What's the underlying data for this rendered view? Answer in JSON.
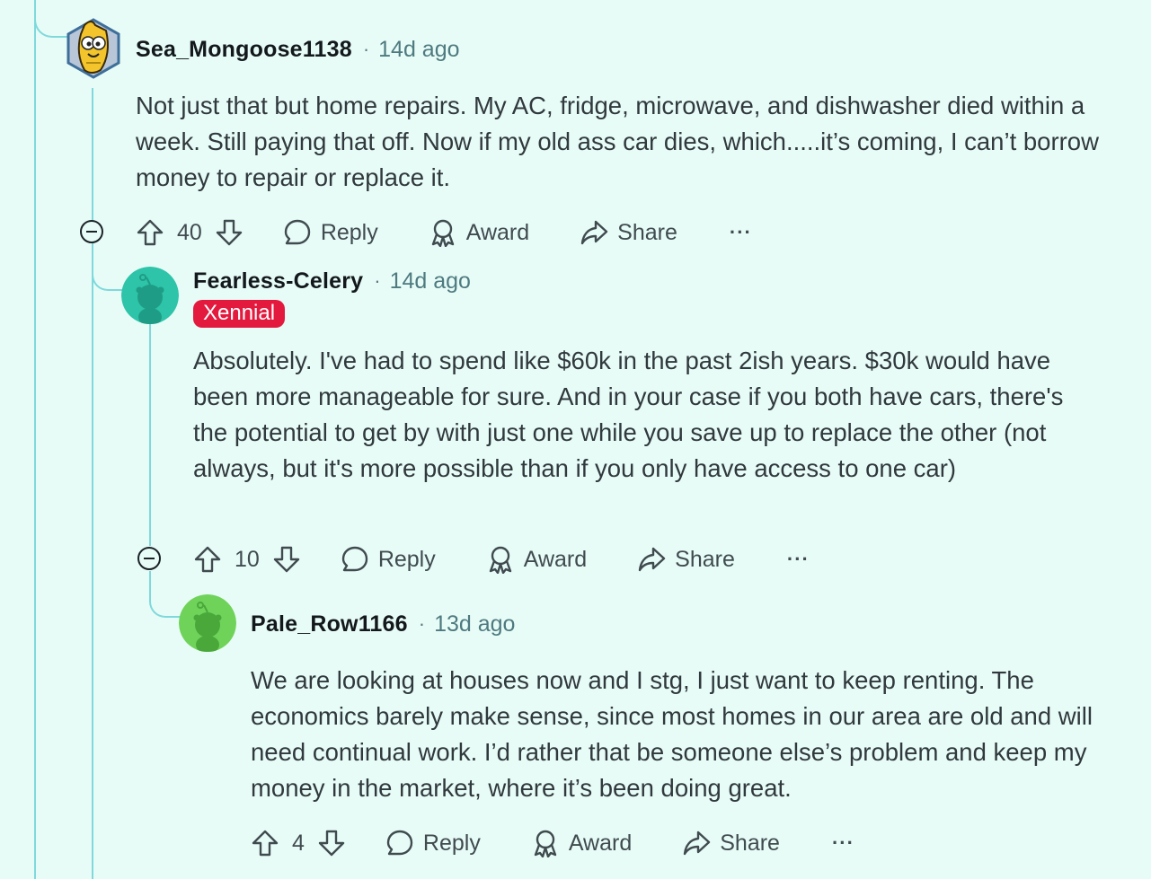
{
  "comments": [
    {
      "username": "Sea_Mongoose1138",
      "time": "14d ago",
      "avatar_icon": "banana-snoo-avatar-icon",
      "body": "Not just that but home repairs. My AC, fridge, microwave, and dishwasher died within a week. Still paying that off. Now if my old ass car dies, which.....it’s coming, I can’t borrow money to repair or replace it.",
      "votes": "40",
      "reply": "Reply",
      "award": "Award",
      "share": "Share",
      "more": "···"
    },
    {
      "username": "Fearless-Celery",
      "time": "14d ago",
      "flair": "Xennial",
      "avatar_icon": "teal-snoo-avatar-icon",
      "body": "Absolutely. I've had to spend like $60k in the past 2ish years. $30k would have been more manageable for sure. And in your case if you both have cars, there's the potential to get by with just one while you save up to replace the other (not always, but it's more possible than if you only have access to one car)",
      "votes": "10",
      "reply": "Reply",
      "award": "Award",
      "share": "Share",
      "more": "···"
    },
    {
      "username": "Pale_Row1166",
      "time": "13d ago",
      "avatar_icon": "green-snoo-avatar-icon",
      "body": "We are looking at houses now and I stg, I just want to keep renting. The economics barely make sense, since most homes in our area are old and will need continual work. I’d rather that be someone else’s problem and keep my money in the market, where it’s been doing great.",
      "votes": "4",
      "reply": "Reply",
      "award": "Award",
      "share": "Share",
      "more": "···"
    }
  ],
  "separator": "·",
  "colors": {
    "background": "#e8fcf7",
    "thread_line": "#7fd9dc",
    "flair_bg": "#e3193e",
    "avatar_teal": "#2ec4a9",
    "avatar_green": "#6fd35a"
  }
}
